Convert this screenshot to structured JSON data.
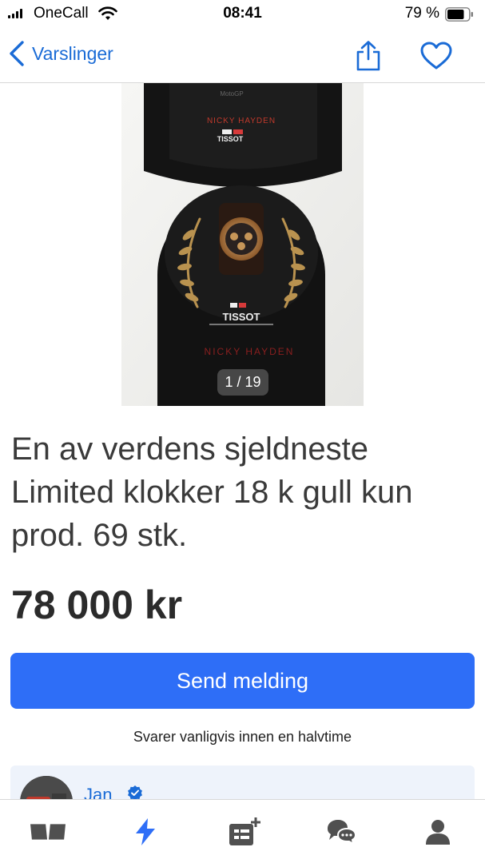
{
  "status_bar": {
    "carrier": "OneCall",
    "time": "08:41",
    "battery_percent": "79 %",
    "battery_level": 0.79
  },
  "nav": {
    "back_label": "Varslinger",
    "icons": [
      "chevron-left-icon",
      "share-icon",
      "heart-icon"
    ]
  },
  "gallery": {
    "counter": "1 / 19"
  },
  "listing": {
    "title": "En av verdens sjeldneste Limited klokker 18 k gull kun prod. 69 stk.",
    "price": "78 000 kr"
  },
  "contact": {
    "send_label": "Send melding",
    "response_note": "Svarer vanligvis innen en halvtime"
  },
  "seller": {
    "name": "Jan"
  },
  "colors": {
    "accent": "#2e6ef7",
    "link": "#1a6bd6",
    "tab_active": "#2e6ef7",
    "tab_inactive": "#505050"
  },
  "tab_bar": {
    "items": [
      "market-icon",
      "notifications-icon",
      "new-ad-icon",
      "messages-icon",
      "profile-icon"
    ],
    "active": "notifications-icon"
  }
}
